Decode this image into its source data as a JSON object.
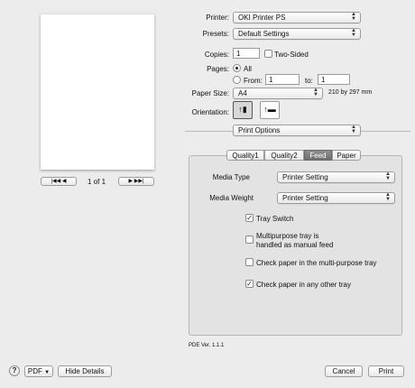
{
  "printer": {
    "label": "Printer:",
    "value": "OKI Printer PS"
  },
  "presets": {
    "label": "Presets:",
    "value": "Default Settings"
  },
  "copies": {
    "label": "Copies:",
    "value": "1",
    "two_sided_label": "Two-Sided"
  },
  "pages": {
    "label": "Pages:",
    "all_label": "All",
    "from_label": "From:",
    "from_value": "1",
    "to_label": "to:",
    "to_value": "1"
  },
  "paper_size": {
    "label": "Paper Size:",
    "value": "A4",
    "dimensions": "210 by 297 mm"
  },
  "orientation": {
    "label": "Orientation:",
    "portrait_icon": "portrait-orientation-icon",
    "landscape_icon": "landscape-orientation-icon"
  },
  "section_popup": {
    "value": "Print Options"
  },
  "tabs": [
    {
      "label": "Quality1"
    },
    {
      "label": "Quality2"
    },
    {
      "label": "Feed",
      "selected": true
    },
    {
      "label": "Paper"
    }
  ],
  "feed": {
    "media_type_label": "Media Type",
    "media_type_value": "Printer Setting",
    "media_weight_label": "Media Weight",
    "media_weight_value": "Printer Setting",
    "tray_switch_label": "Tray Switch",
    "tray_switch_checked": true,
    "multipurpose_line1": "Multipurpose tray is",
    "multipurpose_line2": "handled as manual feed",
    "multipurpose_checked": false,
    "check_mp_label": "Check paper in the multi-purpose tray",
    "check_mp_checked": false,
    "check_other_label": "Check paper in any other tray",
    "check_other_checked": true
  },
  "preview": {
    "page_counter": "1 of 1"
  },
  "pde_version": "PDE Ver. 1.1.1",
  "footer": {
    "help": "?",
    "pdf_label": "PDF",
    "hide_details_label": "Hide Details",
    "cancel_label": "Cancel",
    "print_label": "Print"
  },
  "colors": {
    "selected_tab": "#7a7a7a",
    "panel": "#e3e3e3",
    "background": "#ececec"
  }
}
